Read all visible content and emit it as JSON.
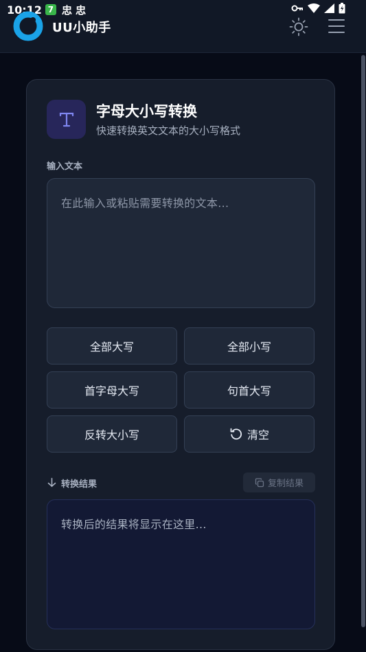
{
  "status_bar": {
    "time": "10:12",
    "notification_badge": "7",
    "notification_glyphs": "忠 忠"
  },
  "app": {
    "title": "UU小助手",
    "brand_color": "#1aa3e8"
  },
  "tool": {
    "title": "字母大小写转换",
    "subtitle": "快速转换英文文本的大小写格式",
    "icon": "text-T-icon",
    "accent_color": "#7f86f0"
  },
  "input": {
    "label": "输入文本",
    "placeholder": "在此输入或粘贴需要转换的文本...",
    "value": ""
  },
  "buttons": {
    "uppercase": "全部大写",
    "lowercase": "全部小写",
    "capitalize_words": "首字母大写",
    "sentence_case": "句首大写",
    "toggle_case": "反转大小写",
    "clear": "清空"
  },
  "result": {
    "label": "转换结果",
    "copy_label": "复制结果",
    "placeholder": "转换后的结果将显示在这里..."
  }
}
